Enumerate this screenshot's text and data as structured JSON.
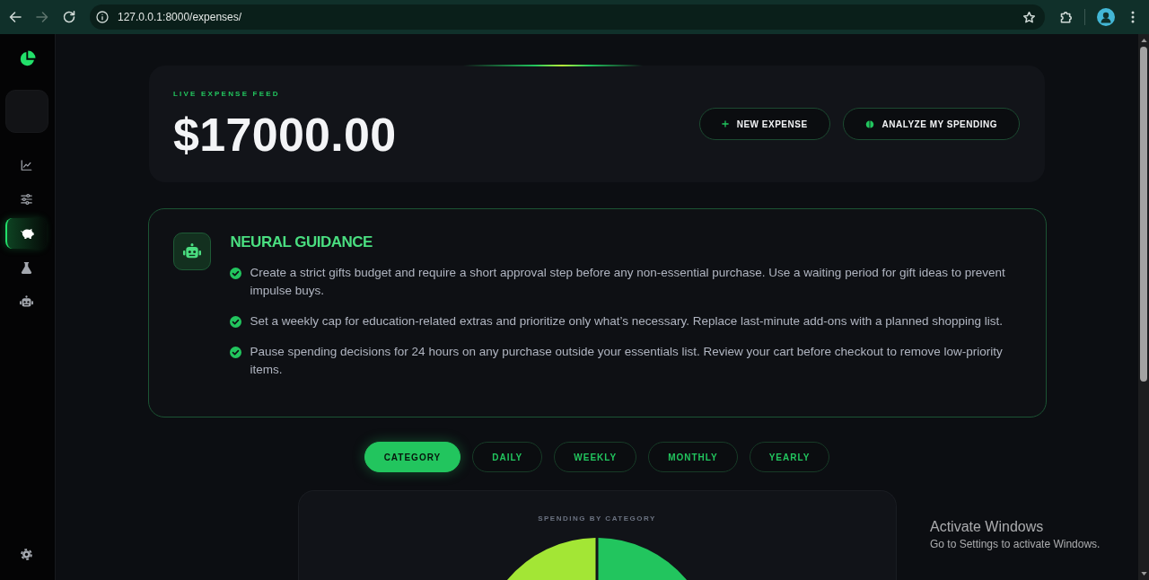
{
  "browser": {
    "url": "127.0.0.1:8000/expenses/",
    "forward_disabled": true
  },
  "sidebar": {
    "nav_items": [
      {
        "selected": false
      },
      {
        "selected": false
      },
      {
        "selected": true
      },
      {
        "selected": false
      },
      {
        "selected": false
      }
    ]
  },
  "header": {
    "eyebrow": "LIVE EXPENSE FEED",
    "total": "$17000.00",
    "buttons": [
      {
        "kind": "add",
        "label": "NEW EXPENSE"
      },
      {
        "kind": "analyze",
        "label": "ANALYZE MY SPENDING"
      }
    ]
  },
  "guidance": {
    "title": "NEURAL GUIDANCE",
    "tips": [
      "Create a strict gifts budget and require a short approval step before any non-essential purchase. Use a waiting period for gift ideas to prevent impulse buys.",
      "Set a weekly cap for education-related extras and prioritize only what’s necessary. Replace last-minute add-ons with a planned shopping list.",
      "Pause spending decisions for 24 hours on any purchase outside your essentials list. Review your cart before checkout to remove low-priority items."
    ]
  },
  "view_tabs": [
    {
      "label": "CATEGORY",
      "selected": true
    },
    {
      "label": "DAILY",
      "selected": false
    },
    {
      "label": "WEEKLY",
      "selected": false
    },
    {
      "label": "MONTHLY",
      "selected": false
    },
    {
      "label": "YEARLY",
      "selected": false
    }
  ],
  "chart": {
    "title": "SPENDING BY CATEGORY"
  },
  "windows_activation": {
    "title": "Activate Windows",
    "message": "Go to Settings to activate Windows."
  }
}
